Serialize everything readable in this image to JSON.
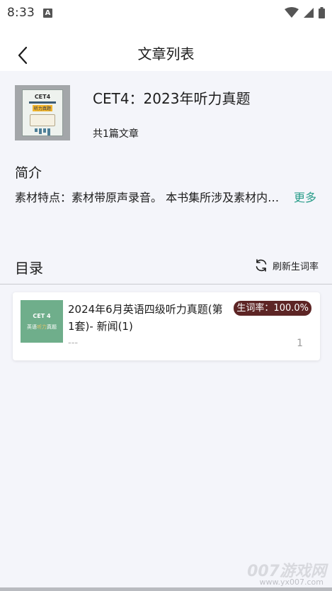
{
  "status_bar": {
    "time": "8:33",
    "notification_badge": "A",
    "icons": [
      "wifi-icon",
      "signal-icon",
      "battery-icon"
    ]
  },
  "header": {
    "back_icon": "chevron-left-icon",
    "title": "文章列表"
  },
  "book": {
    "cover_icon": "book-cover-image",
    "cover_label": "CET4",
    "cover_sub_label": "听力真题",
    "title": "CET4：2023年听力真题",
    "article_count": "共1篇文章"
  },
  "intro": {
    "heading": "简介",
    "text": "素材特点：素材带原声录音。 本书集所涉及素材内容包括历年英语四级听力真题",
    "more_label": "更多"
  },
  "toc": {
    "heading": "目录",
    "refresh_icon": "refresh-icon",
    "refresh_label": "刷新生词率"
  },
  "articles": [
    {
      "thumb_label": "CET 4",
      "thumb_sub_prefix": "英语",
      "thumb_sub_highlight": "听力",
      "thumb_sub_suffix": "真题",
      "title": "2024年6月英语四级听力真题(第1套)- 新闻(1)",
      "rate_badge": "生词率：100.0%",
      "dash": "---",
      "index": "1"
    }
  ],
  "watermark": {
    "main": "007游戏网",
    "url": "www.yx007.com"
  },
  "colors": {
    "accent_link": "#2a9d8a",
    "rate_badge_bg": "#5d2525",
    "thumb_bg": "#6fae8b",
    "page_bg": "#f4f5fa"
  }
}
